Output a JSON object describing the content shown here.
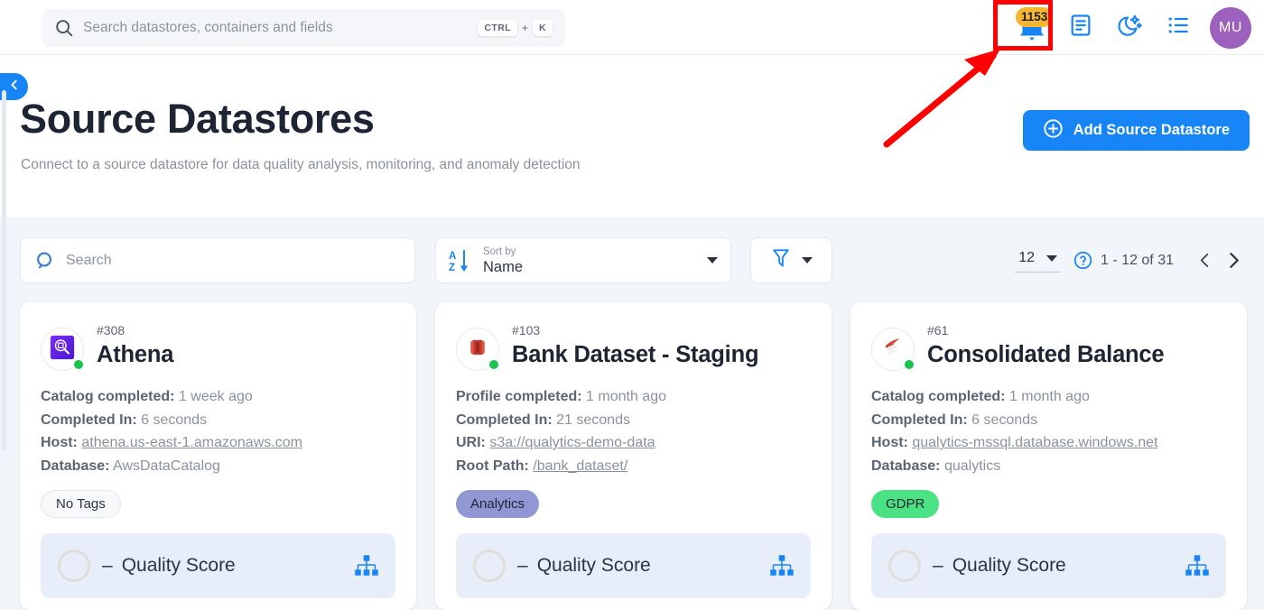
{
  "topbar": {
    "search_placeholder": "Search datastores, containers and fields",
    "search_value": "",
    "kbd_ctrl": "CTRL",
    "kbd_plus": "+",
    "kbd_key": "K",
    "notification_badge": "1153",
    "icons": {
      "search": "search-icon",
      "bell": "notification-bell-icon",
      "docs": "document-icon",
      "dark_mode": "moon-icon",
      "activity_list": "list-icon"
    },
    "avatar_initials": "MU"
  },
  "annotation": {
    "highlight_color": "#ff0000",
    "arrow_color": "#ff0000",
    "target": "notification-bell-icon"
  },
  "header": {
    "title": "Source Datastores",
    "subtitle": "Connect to a source datastore for data quality analysis, monitoring, and anomaly detection",
    "add_button": "Add Source Datastore",
    "collapse_icon": "chevron-left-icon"
  },
  "toolbar": {
    "search_placeholder": "Search",
    "search_value": "",
    "sort_label": "Sort by",
    "sort_value": "Name",
    "filter_icon": "filter-icon",
    "page_size": "12",
    "page_range": "1 - 12 of 31",
    "prev_icon": "chevron-left-icon",
    "next_icon": "chevron-right-icon",
    "help_icon": "help-circle-icon"
  },
  "cards": [
    {
      "id": "#308",
      "name": "Athena",
      "icon": "aws-athena-icon",
      "status": "online",
      "meta": [
        {
          "key": "Catalog completed:",
          "value": "1 week ago",
          "link": false
        },
        {
          "key": "Completed In:",
          "value": "6 seconds",
          "link": false
        },
        {
          "key": "Host:",
          "value": "athena.us-east-1.amazonaws.com",
          "link": true
        },
        {
          "key": "Database:",
          "value": "AwsDataCatalog",
          "link": false
        }
      ],
      "tag": {
        "label": "No Tags",
        "style": "none"
      },
      "quality": {
        "dash": "–",
        "label": "Quality Score",
        "tree_icon": "hierarchy-icon"
      }
    },
    {
      "id": "#103",
      "name": "Bank Dataset - Staging",
      "icon": "aws-s3-icon",
      "status": "online",
      "meta": [
        {
          "key": "Profile completed:",
          "value": "1 month ago",
          "link": false
        },
        {
          "key": "Completed In:",
          "value": "21 seconds",
          "link": false
        },
        {
          "key": "URI:",
          "value": "s3a://qualytics-demo-data",
          "link": true
        },
        {
          "key": "Root Path:",
          "value": "/bank_dataset/",
          "link": true
        }
      ],
      "tag": {
        "label": "Analytics",
        "style": "analytics"
      },
      "quality": {
        "dash": "–",
        "label": "Quality Score",
        "tree_icon": "hierarchy-icon"
      }
    },
    {
      "id": "#61",
      "name": "Consolidated Balance",
      "icon": "mssql-icon",
      "status": "online",
      "meta": [
        {
          "key": "Catalog completed:",
          "value": "1 month ago",
          "link": false
        },
        {
          "key": "Completed In:",
          "value": "6 seconds",
          "link": false
        },
        {
          "key": "Host:",
          "value": "qualytics-mssql.database.windows.net",
          "link": true
        },
        {
          "key": "Database:",
          "value": "qualytics",
          "link": false
        }
      ],
      "tag": {
        "label": "GDPR",
        "style": "gdpr"
      },
      "quality": {
        "dash": "–",
        "label": "Quality Score",
        "tree_icon": "hierarchy-icon"
      }
    }
  ],
  "colors": {
    "accent": "#1785f5",
    "badge": "#f5b731",
    "status_online": "#18c54f",
    "avatar": "#9d61bd",
    "page_bg": "#f2f5fa",
    "quality_bar": "#e7eef9"
  }
}
